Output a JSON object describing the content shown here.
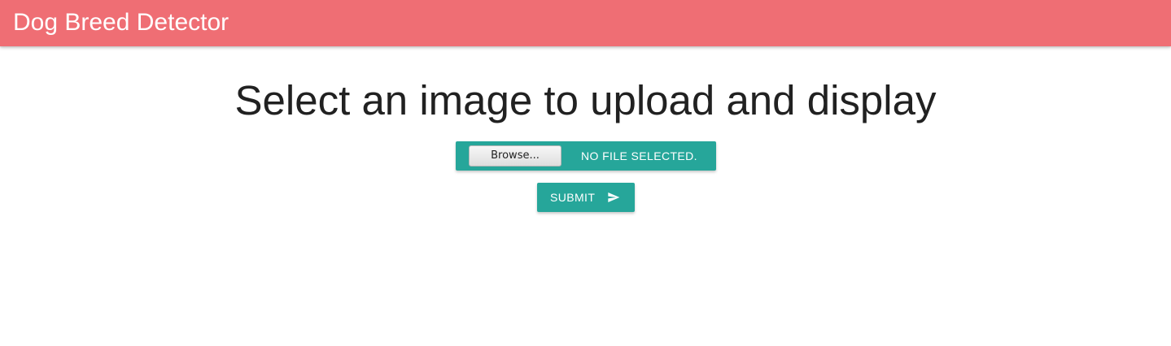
{
  "navbar": {
    "brand": "Dog Breed Detector",
    "color": "#ef6e74"
  },
  "main": {
    "title": "Select an image to upload and display",
    "file_input": {
      "browse_label": "Browse...",
      "status": "NO FILE SELECTED."
    },
    "submit": {
      "label": "SUBMIT",
      "icon": "send-icon"
    },
    "accent_color": "#26a69a"
  }
}
